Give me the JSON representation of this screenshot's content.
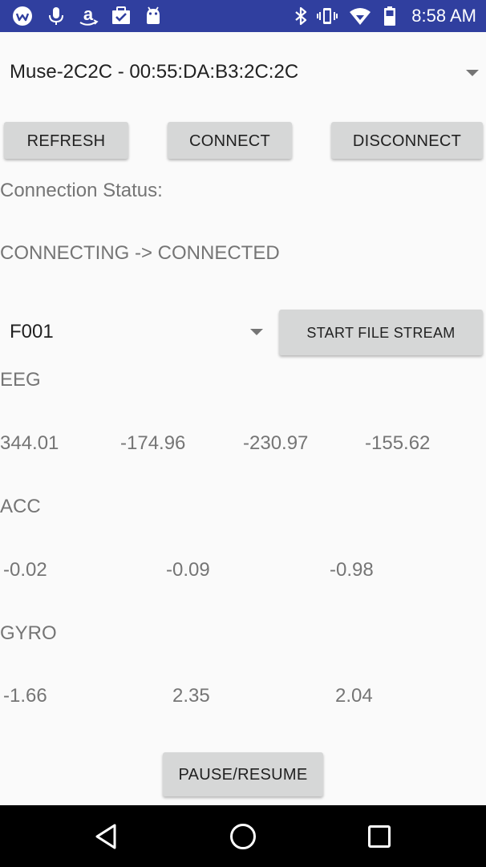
{
  "status_bar": {
    "time": "8:58 AM",
    "left_icons": [
      "wifi-calling-app-icon",
      "microphone-icon",
      "amazon-icon",
      "task-checklist-icon",
      "android-icon"
    ],
    "right_icons": [
      "bluetooth-icon",
      "vibrate-icon",
      "wifi-icon",
      "battery-icon"
    ],
    "bg_color": "#303f9f"
  },
  "device_spinner": {
    "selected": "Muse-2C2C - 00:55:DA:B3:2C:2C"
  },
  "buttons": {
    "refresh": "REFRESH",
    "connect": "CONNECT",
    "disconnect": "DISCONNECT",
    "start_file_stream": "START FILE STREAM",
    "pause_resume": "PAUSE/RESUME"
  },
  "connection": {
    "label": "Connection Status:",
    "status": "CONNECTING -> CONNECTED"
  },
  "file_spinner": {
    "selected": "F001"
  },
  "eeg": {
    "label": "EEG",
    "values": [
      "344.01",
      "-174.96",
      "-230.97",
      "-155.62"
    ]
  },
  "acc": {
    "label": "ACC",
    "values": [
      "-0.02",
      "-0.09",
      "-0.98"
    ]
  },
  "gyro": {
    "label": "GYRO",
    "values": [
      "-1.66",
      "2.35",
      "2.04"
    ]
  },
  "nav_bar": {
    "icons": [
      "back-icon",
      "home-icon",
      "recents-icon"
    ]
  }
}
